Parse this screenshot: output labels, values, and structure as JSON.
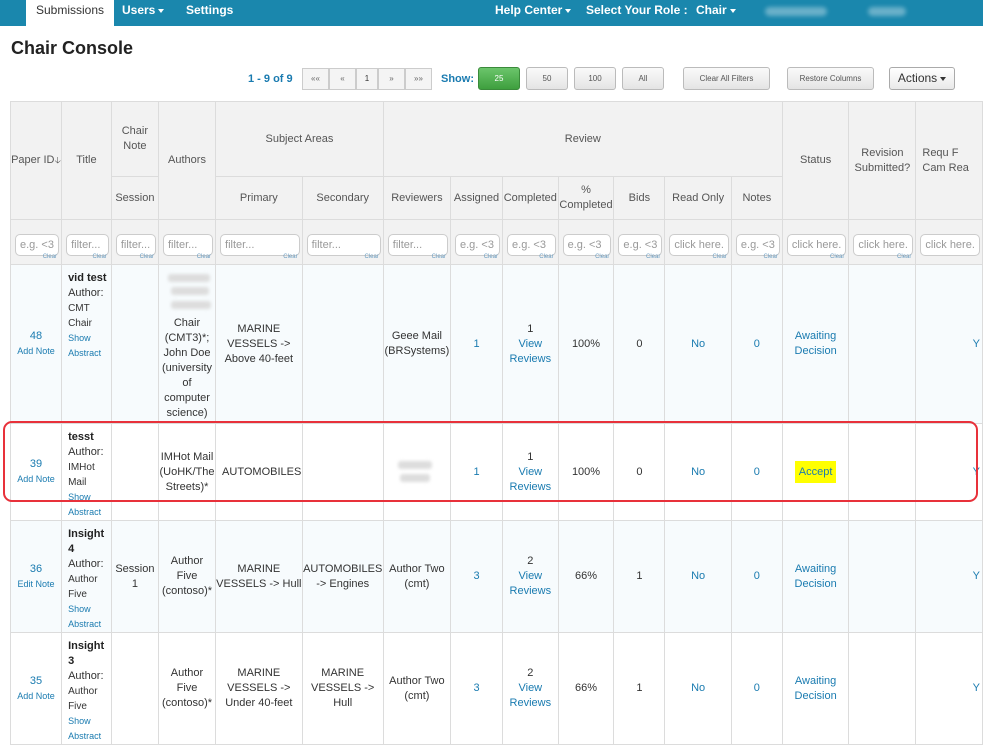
{
  "nav": {
    "submissions": "Submissions",
    "users": "Users",
    "settings": "Settings",
    "help": "Help Center",
    "role_label": "Select Your Role :",
    "role": "Chair"
  },
  "page_title": "Chair Console",
  "paging": {
    "range": "1 - 9 of 9",
    "first": "««",
    "prev": "«",
    "page": "1",
    "next": "»",
    "last": "»»"
  },
  "show": {
    "label": "Show:",
    "options": [
      "25",
      "50",
      "100",
      "All"
    ],
    "selected": "25"
  },
  "toolbar": {
    "clear_filters": "Clear All Filters",
    "restore_columns": "Restore Columns",
    "actions": "Actions"
  },
  "headers": {
    "paper_id": "Paper ID",
    "title": "Title",
    "chair_note": "Chair Note",
    "session": "Session",
    "authors": "Authors",
    "subject_areas": "Subject Areas",
    "primary": "Primary",
    "secondary": "Secondary",
    "review": "Review",
    "reviewers": "Reviewers",
    "assigned": "Assigned",
    "completed": "Completed",
    "pct_completed": "% Completed",
    "bids": "Bids",
    "read_only": "Read Only",
    "notes": "Notes",
    "status": "Status",
    "revision": "Revision Submitted?",
    "request": "Requ F Cam Rea"
  },
  "filters": {
    "eg": "e.g. <3",
    "filter": "filter...",
    "click": "click here.",
    "clear": "Clear"
  },
  "rows": [
    {
      "id": "48",
      "note_link": "Add Note",
      "title": "vid test",
      "author_label": "Author:",
      "author_name": "CMT Chair",
      "show_abstract": "Show Abstract",
      "session": "",
      "authors": "Chair (CMT3)*; John Doe (university of computer science)",
      "primary": "MARINE VESSELS -> Above 40-feet",
      "secondary": "",
      "reviewers": "Geee Mail (BRSystems)",
      "assigned": "1",
      "completed": "1",
      "view_reviews": "View Reviews",
      "pct": "100%",
      "bids": "0",
      "read_only": "No",
      "notes": "0",
      "status": "Awaiting Decision",
      "extra": "Y"
    },
    {
      "id": "39",
      "note_link": "Add Note",
      "title": "tesst",
      "author_label": "Author:",
      "author_name": "IMHot Mail",
      "show_abstract": "Show Abstract",
      "session": "",
      "authors": "IMHot Mail (UoHK/The Streets)*",
      "primary": "AUTOMOBILES",
      "secondary": "",
      "reviewers": "",
      "assigned": "1",
      "completed": "1",
      "view_reviews": "View Reviews",
      "pct": "100%",
      "bids": "0",
      "read_only": "No",
      "notes": "0",
      "status": "Accept",
      "extra": "Y"
    },
    {
      "id": "36",
      "note_link": "Edit Note",
      "title": "Insight 4",
      "author_label": "Author:",
      "author_name": "Author Five",
      "show_abstract": "Show Abstract",
      "session": "Session 1",
      "authors": "Author Five (contoso)*",
      "primary": "MARINE VESSELS -> Hull",
      "secondary": "AUTOMOBILES -> Engines",
      "reviewers": "Author Two (cmt)",
      "assigned": "3",
      "completed": "2",
      "view_reviews": "View Reviews",
      "pct": "66%",
      "bids": "1",
      "read_only": "No",
      "notes": "0",
      "status": "Awaiting Decision",
      "extra": "Y"
    },
    {
      "id": "35",
      "note_link": "Add Note",
      "title": "Insight 3",
      "author_label": "Author:",
      "author_name": "Author Five",
      "show_abstract": "Show Abstract",
      "session": "",
      "authors": "Author Five (contoso)*",
      "primary": "MARINE VESSELS -> Under 40-feet",
      "secondary": "MARINE VESSELS -> Hull",
      "reviewers": "Author Two (cmt)",
      "assigned": "3",
      "completed": "2",
      "view_reviews": "View Reviews",
      "pct": "66%",
      "bids": "1",
      "read_only": "No",
      "notes": "0",
      "status": "Awaiting Decision",
      "extra": "Y"
    }
  ],
  "colors": {
    "nav": "#1a87ad",
    "link": "#1a7bb0",
    "highlight": "#e8313a",
    "accept_bg": "#ffff00",
    "show_active": "#4cae4c"
  }
}
